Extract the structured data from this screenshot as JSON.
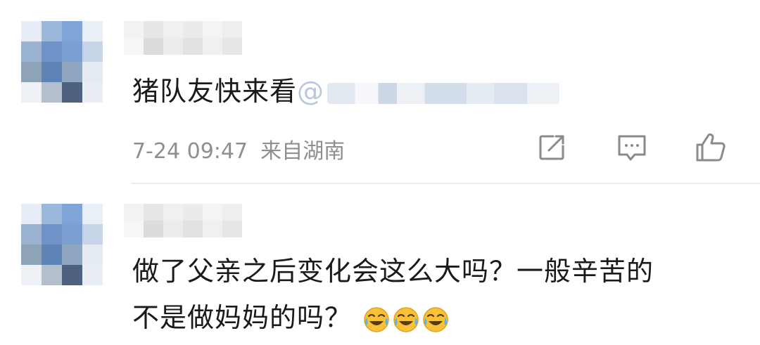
{
  "comments": [
    {
      "text": "猪队友快来看",
      "mention_prefix": "@",
      "timestamp": "7-24 09:47",
      "location": "来自湖南",
      "avatar_icon": "pixelated-avatar",
      "actions": [
        "share-icon",
        "reply-icon",
        "like-icon"
      ]
    },
    {
      "line1": "做了父亲之后变化会这么大吗？一般辛苦的",
      "line2": "不是做妈妈的吗？",
      "emoji_icon": "crying-laughing-emoji",
      "emoji_count": 3,
      "avatar_icon": "pixelated-avatar"
    }
  ],
  "colors": {
    "text": "#1a1a1a",
    "meta": "#8f8f8f",
    "icon": "#8a8a8a",
    "divider": "#ececec",
    "mention": "#b9c8dc",
    "emoji_face": "#f7c23a"
  }
}
